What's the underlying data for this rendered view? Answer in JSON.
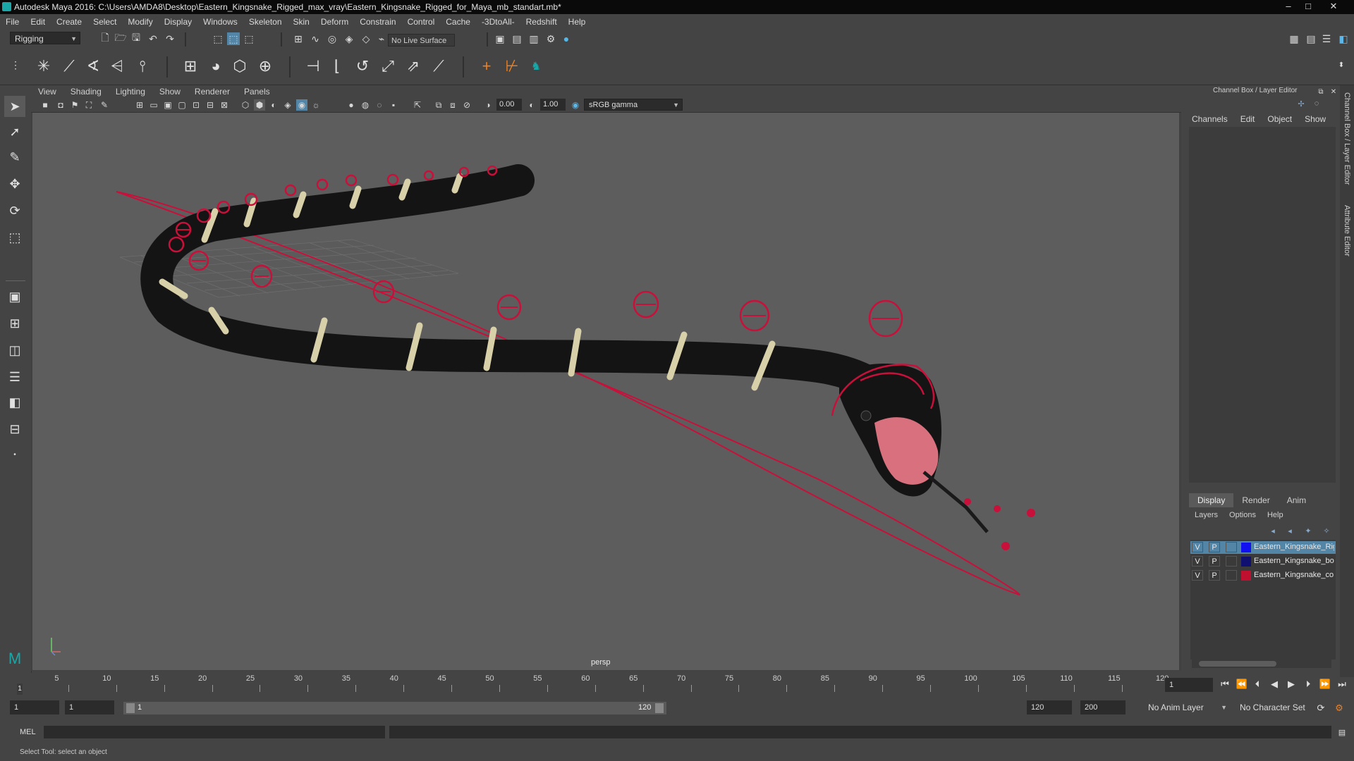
{
  "window": {
    "title": "Autodesk Maya 2016: C:\\Users\\AMDA8\\Desktop\\Eastern_Kingsnake_Rigged_max_vray\\Eastern_Kingsnake_Rigged_for_Maya_mb_standart.mb*",
    "minimize": "–",
    "maximize": "□",
    "close": "✕"
  },
  "menubar": [
    "File",
    "Edit",
    "Create",
    "Select",
    "Modify",
    "Display",
    "Windows",
    "Skeleton",
    "Skin",
    "Deform",
    "Constrain",
    "Control",
    "Cache",
    "-3DtoAll-",
    "Redshift",
    "Help"
  ],
  "statusline": {
    "mode": "Rigging",
    "live_surface": "No Live Surface"
  },
  "viewport": {
    "menu": [
      "View",
      "Shading",
      "Lighting",
      "Show",
      "Renderer",
      "Panels"
    ],
    "exposure": "0.00",
    "gamma": "1.00",
    "color_space": "sRGB gamma",
    "camera_label": "persp"
  },
  "channel_box": {
    "title": "Channel Box / Layer Editor",
    "menu": [
      "Channels",
      "Edit",
      "Object",
      "Show"
    ],
    "side_tabs": [
      "Channel Box / Layer Editor",
      "Attribute Editor"
    ]
  },
  "layer_editor": {
    "tabs": [
      "Display",
      "Render",
      "Anim"
    ],
    "active_tab": "Display",
    "menu": [
      "Layers",
      "Options",
      "Help"
    ],
    "layers": [
      {
        "v": "V",
        "p": "P",
        "color": "#1010f0",
        "name": "Eastern_Kingsnake_Rig",
        "selected": true
      },
      {
        "v": "V",
        "p": "P",
        "color": "#101070",
        "name": "Eastern_Kingsnake_bo",
        "selected": false
      },
      {
        "v": "V",
        "p": "P",
        "color": "#c01030",
        "name": "Eastern_Kingsnake_co",
        "selected": false
      }
    ]
  },
  "timeline": {
    "ticks": [
      "5",
      "10",
      "15",
      "20",
      "25",
      "30",
      "35",
      "40",
      "45",
      "50",
      "55",
      "60",
      "65",
      "70",
      "75",
      "80",
      "85",
      "90",
      "95",
      "100",
      "105",
      "110",
      "115",
      "120"
    ],
    "start_marker": "1",
    "current_frame": "1"
  },
  "range": {
    "start": "1",
    "playback_start": "1",
    "slider_start": "1",
    "slider_end": "120",
    "playback_end": "120",
    "end": "200",
    "anim_layer": "No Anim Layer",
    "character_set": "No Character Set"
  },
  "command": {
    "language": "MEL",
    "help": "Select Tool: select an object"
  },
  "colors": {
    "rig_control": "#c8103a",
    "viewport_bg": "#5d5d5d",
    "selection": "#5285a6"
  }
}
